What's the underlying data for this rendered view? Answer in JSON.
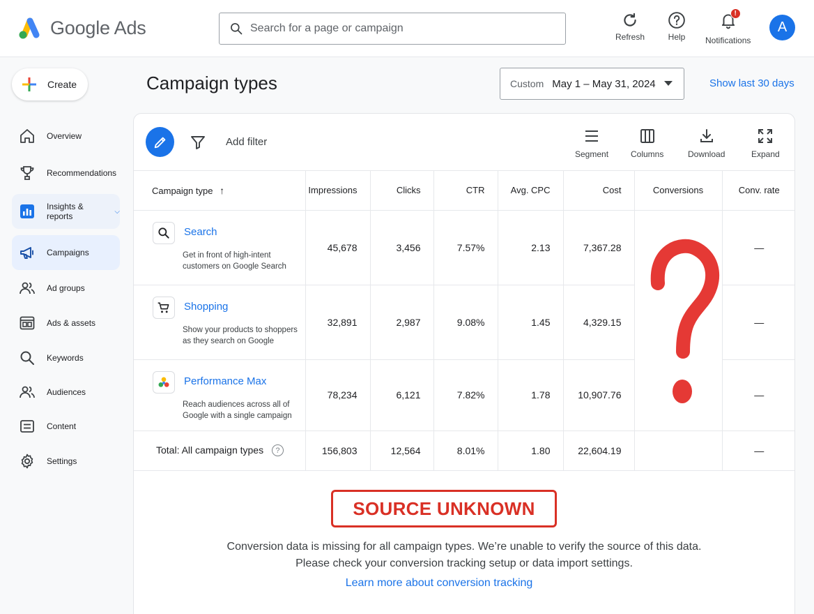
{
  "app": {
    "name": "Google Ads"
  },
  "search": {
    "placeholder": "Search for a page or campaign"
  },
  "topbar": {
    "refresh_label": "Refresh",
    "help_label": "Help",
    "notifications_label": "Notifications",
    "notifications_badge": "!",
    "avatar_initial": "A"
  },
  "sidebar": {
    "create_label": "Create",
    "items": [
      {
        "label": "Overview",
        "icon": "home-icon"
      },
      {
        "label": "Recommendations",
        "icon": "trophy-icon"
      },
      {
        "label": "Insights & reports",
        "icon": "bar-chart-icon"
      },
      {
        "label": "Campaigns",
        "icon": "megaphone-icon"
      },
      {
        "label": "Ad groups",
        "icon": "people-icon"
      },
      {
        "label": "Ads & assets",
        "icon": "ad-icon"
      },
      {
        "label": "Keywords",
        "icon": "search-icon"
      },
      {
        "label": "Audiences",
        "icon": "people-icon"
      },
      {
        "label": "Content",
        "icon": "content-icon"
      },
      {
        "label": "Settings",
        "icon": "gear-icon"
      }
    ]
  },
  "page": {
    "title": "Campaign types"
  },
  "date_range": {
    "label": "Custom",
    "value": "May 1 – May 31, 2024",
    "show_last": "Show last 30 days"
  },
  "toolbar": {
    "add_filter": "Add filter",
    "segment": "Segment",
    "columns": "Columns",
    "download": "Download",
    "expand": "Expand"
  },
  "table": {
    "headers": [
      "Campaign type",
      "Impressions",
      "Clicks",
      "CTR",
      "Avg. CPC",
      "Cost",
      "Conversions",
      "Conv. rate"
    ],
    "rows": [
      {
        "name": "Search",
        "desc": "Get in front of high-intent customers on Google Search",
        "impressions": "45,678",
        "clicks": "3,456",
        "ctr": "7.57%",
        "cpc": "2.13",
        "cost": "7,367.28",
        "conv_rate": "—"
      },
      {
        "name": "Shopping",
        "desc": "Show your products to shoppers as they search on Google",
        "impressions": "32,891",
        "clicks": "2,987",
        "ctr": "9.08%",
        "cpc": "1.45",
        "cost": "4,329.15",
        "conv_rate": "—"
      },
      {
        "name": "Performance Max",
        "desc": "Reach audiences across all of Google with a single campaign",
        "impressions": "78,234",
        "clicks": "6,121",
        "ctr": "7.82%",
        "cpc": "1.78",
        "cost": "10,907.76",
        "conv_rate": "—"
      }
    ],
    "total": {
      "label": "Total: All campaign types",
      "help": "?",
      "impressions": "156,803",
      "clicks": "12,564",
      "ctr": "8.01%",
      "cpc": "1.80",
      "cost": "22,604.19",
      "conv_rate": "—"
    }
  },
  "notice": {
    "badge": "SOURCE UNKNOWN",
    "line1": "Conversion data is missing for all campaign types. We’re unable to verify the source of this data.",
    "line2": "Please check your conversion tracking setup or data import settings.",
    "link": "Learn more about conversion tracking"
  },
  "colors": {
    "accent": "#1a73e8",
    "warning": "#d93025"
  }
}
